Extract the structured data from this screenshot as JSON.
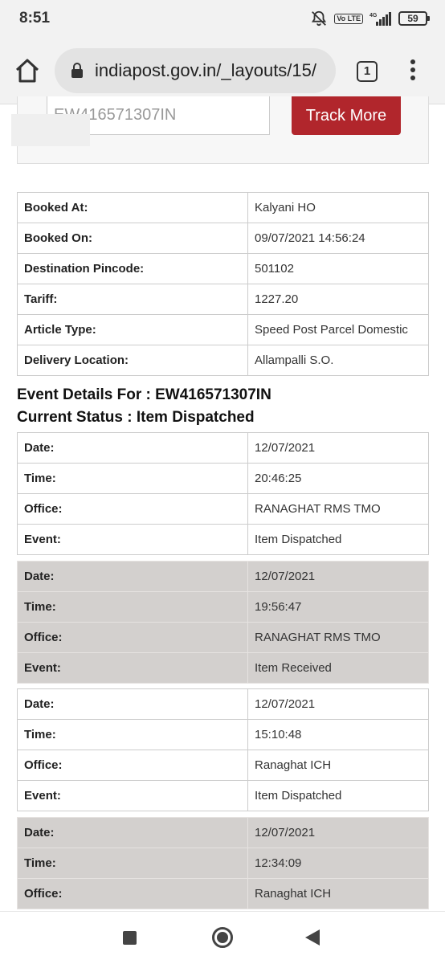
{
  "status_bar": {
    "time": "8:51",
    "network": "4G",
    "volte": "Vo LTE",
    "battery": "59"
  },
  "browser": {
    "url": "indiapost.gov.in/_layouts/15/",
    "tab_count": "1"
  },
  "search": {
    "tracking_value": "EW416571307IN",
    "track_more_label": "Track More"
  },
  "booking": [
    {
      "label": "Booked At:",
      "value": "Kalyani HO"
    },
    {
      "label": "Booked On:",
      "value": "09/07/2021 14:56:24"
    },
    {
      "label": "Destination Pincode:",
      "value": "501102"
    },
    {
      "label": "Tariff:",
      "value": "1227.20"
    },
    {
      "label": "Article Type:",
      "value": "Speed Post Parcel Domestic"
    },
    {
      "label": "Delivery Location:",
      "value": "Allampalli S.O."
    }
  ],
  "event_heading": {
    "line1": "Event Details For : EW416571307IN",
    "line2": "Current Status : Item Dispatched"
  },
  "labels": {
    "date": "Date:",
    "time": "Time:",
    "office": "Office:",
    "event": "Event:"
  },
  "events": [
    {
      "date": "12/07/2021",
      "time": "20:46:25",
      "office": "RANAGHAT RMS TMO",
      "event": "Item Dispatched"
    },
    {
      "date": "12/07/2021",
      "time": "19:56:47",
      "office": "RANAGHAT RMS TMO",
      "event": "Item Received"
    },
    {
      "date": "12/07/2021",
      "time": "15:10:48",
      "office": "Ranaghat ICH",
      "event": "Item Dispatched"
    },
    {
      "date": "12/07/2021",
      "time": "12:34:09",
      "office": "Ranaghat ICH"
    }
  ]
}
